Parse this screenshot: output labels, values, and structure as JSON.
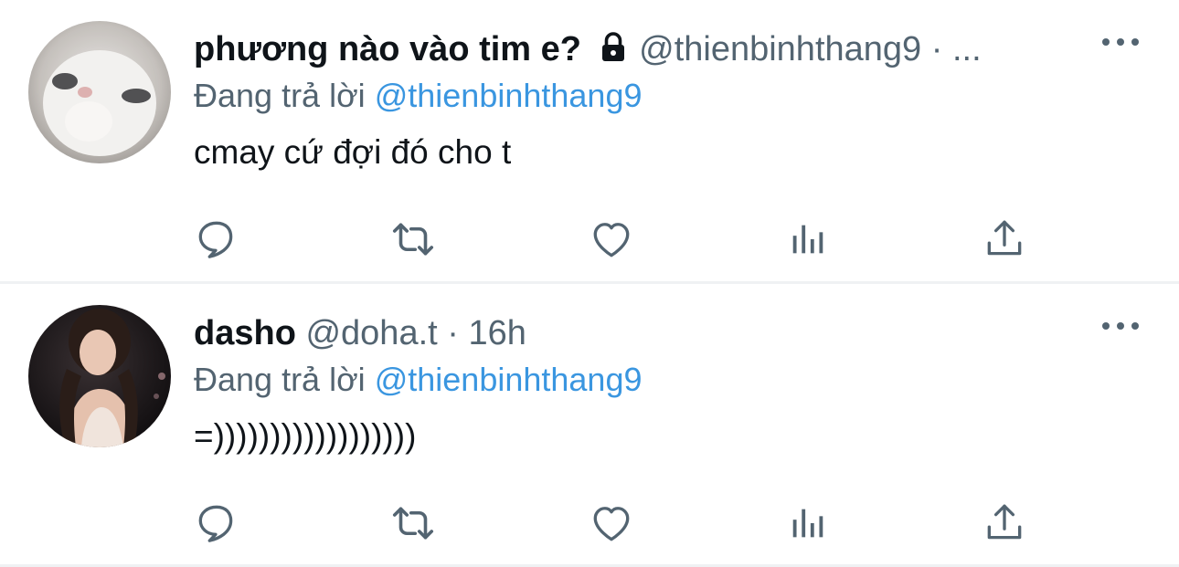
{
  "tweets": [
    {
      "name": "phương nào vào tim e?",
      "handle": "@thienbinhthang9",
      "separator": "·",
      "time": "...",
      "reply_prefix": "Đang trả lời",
      "reply_to": "@thienbinhthang9",
      "text": "cmay cứ đợi đó cho t",
      "protected_icon": "lock-icon",
      "avatar": "cat-photo"
    },
    {
      "name": "dasho",
      "handle": "@doha.t",
      "separator": "·",
      "time": "16h",
      "reply_prefix": "Đang trả lời",
      "reply_to": "@thienbinhthang9",
      "text": "=))))))))))))))))))",
      "avatar": "portrait-photo"
    }
  ],
  "actions": [
    "reply-icon",
    "retweet-icon",
    "like-icon",
    "analytics-icon",
    "share-icon"
  ],
  "colors": {
    "link": "#3a96e0",
    "secondary": "#536471",
    "primary": "#0f1419",
    "divider": "#eff1f3"
  }
}
